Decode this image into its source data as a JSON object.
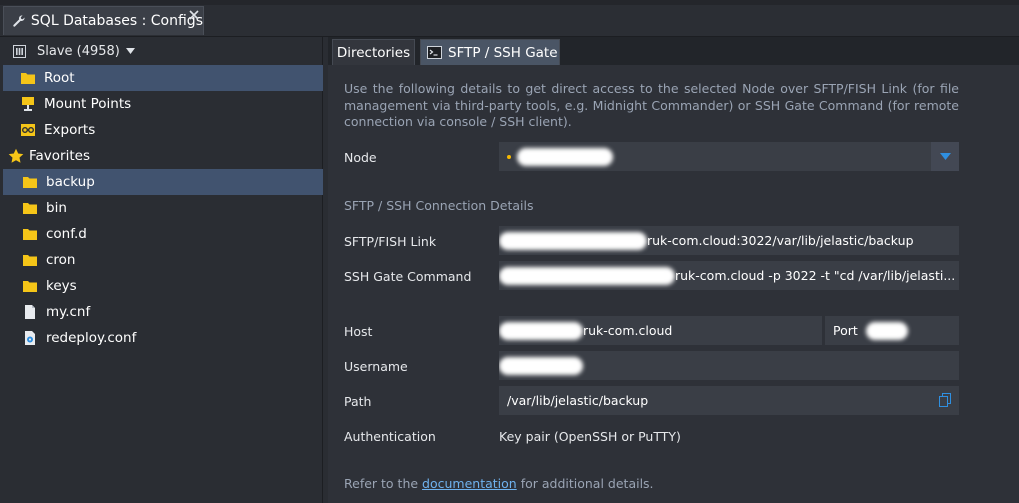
{
  "window": {
    "tab_title": "SQL Databases : Configs",
    "tab_icon": "wrench-icon",
    "close_icon": "close-icon"
  },
  "left": {
    "node_selector": "Slave (4958)",
    "tree": [
      {
        "label": "Root",
        "icon": "folder-icon",
        "selected": true
      },
      {
        "label": "Mount Points",
        "icon": "mount-points-icon"
      },
      {
        "label": "Exports",
        "icon": "exports-icon"
      }
    ],
    "favorites_label": "Favorites",
    "favorites": [
      {
        "label": "backup",
        "icon": "folder-icon",
        "selected": true
      },
      {
        "label": "bin",
        "icon": "folder-icon"
      },
      {
        "label": "conf.d",
        "icon": "folder-icon"
      },
      {
        "label": "cron",
        "icon": "folder-icon"
      },
      {
        "label": "keys",
        "icon": "folder-icon"
      },
      {
        "label": "my.cnf",
        "icon": "file-icon"
      },
      {
        "label": "redeploy.conf",
        "icon": "config-file-icon"
      }
    ]
  },
  "tabs": {
    "directories": "Directories",
    "ssh": "SFTP / SSH Gate",
    "active": "ssh"
  },
  "content": {
    "description": "Use the following details to get direct access to the selected Node over SFTP/FISH Link (for file management via third-party tools, e.g. Midnight Commander) or SSH Gate Command (for remote connection via console / SSH client).",
    "node_label": "Node",
    "section_title": "SFTP / SSH Connection Details",
    "sftp_label": "SFTP/FISH Link",
    "sftp_value": "ruk-com.cloud:3022/var/lib/jelastic/backup",
    "ssh_label": "SSH Gate Command",
    "ssh_value": "ruk-com.cloud -p 3022 -t \"cd /var/lib/jelasti...",
    "host_label": "Host",
    "host_value": "ruk-com.cloud",
    "port_label": "Port",
    "username_label": "Username",
    "path_label": "Path",
    "path_value": "/var/lib/jelastic/backup",
    "auth_label": "Authentication",
    "auth_value": "Key pair (OpenSSH or PuTTY)",
    "footer_prefix": "Refer to the",
    "footer_link": "documentation",
    "footer_suffix": "for additional details."
  },
  "colors": {
    "selection": "#41536f",
    "link": "#6fb2ee",
    "folder": "#f5c518",
    "accent_blue": "#2f8fe0"
  }
}
